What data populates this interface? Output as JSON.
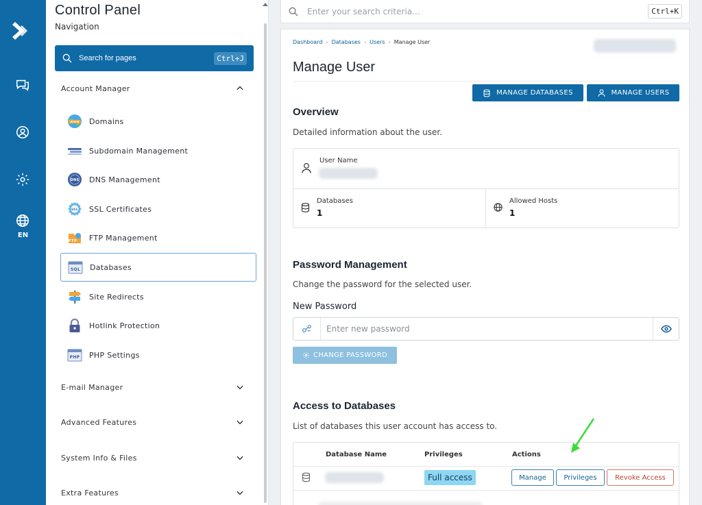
{
  "rail": {
    "language": "EN"
  },
  "sidebar": {
    "title": "Control Panel",
    "subtitle": "Navigation",
    "search_label": "Search for pages",
    "search_shortcut": "Ctrl+J",
    "sections": [
      {
        "label": "Account Manager",
        "expanded": true
      },
      {
        "label": "E-mail Manager",
        "expanded": false
      },
      {
        "label": "Advanced Features",
        "expanded": false
      },
      {
        "label": "System Info & Files",
        "expanded": false
      },
      {
        "label": "Extra Features",
        "expanded": false
      }
    ],
    "items": [
      {
        "label": "Domains",
        "icon": "www-globe-icon"
      },
      {
        "label": "Subdomain Management",
        "icon": "subdomain-icon"
      },
      {
        "label": "DNS Management",
        "icon": "dns-icon"
      },
      {
        "label": "SSL Certificates",
        "icon": "ssl-certificate-icon"
      },
      {
        "label": "FTP Management",
        "icon": "ftp-folder-icon"
      },
      {
        "label": "Databases",
        "icon": "sql-database-icon",
        "active": true
      },
      {
        "label": "Site Redirects",
        "icon": "signpost-icon"
      },
      {
        "label": "Hotlink Protection",
        "icon": "padlock-icon"
      },
      {
        "label": "PHP Settings",
        "icon": "php-icon"
      }
    ]
  },
  "topbar": {
    "search_placeholder": "Enter your search criteria...",
    "shortcut": "Ctrl+K"
  },
  "breadcrumb": [
    "Dashboard",
    "Databases",
    "Users",
    "Manage User"
  ],
  "page": {
    "title": "Manage User",
    "manage_databases_label": "MANAGE DATABASES",
    "manage_users_label": "MANAGE USERS"
  },
  "overview": {
    "heading": "Overview",
    "description": "Detailed information about the user.",
    "user_name_label": "User Name",
    "databases_label": "Databases",
    "databases_value": "1",
    "allowed_hosts_label": "Allowed Hosts",
    "allowed_hosts_value": "1"
  },
  "password": {
    "heading": "Password Management",
    "description": "Change the password for the selected user.",
    "field_label": "New Password",
    "placeholder": "Enter new password",
    "button_label": "CHANGE PASSWORD"
  },
  "access": {
    "heading": "Access to Databases",
    "description": "List of databases this user account has access to.",
    "columns": [
      "Database Name",
      "Privileges",
      "Actions"
    ],
    "rows": [
      {
        "privileges": "Full access",
        "actions": [
          "Manage",
          "Privileges",
          "Revoke Access"
        ]
      }
    ]
  },
  "colors": {
    "brand": "#0f6aa6",
    "annotation_arrow": "#3ddc3d"
  }
}
